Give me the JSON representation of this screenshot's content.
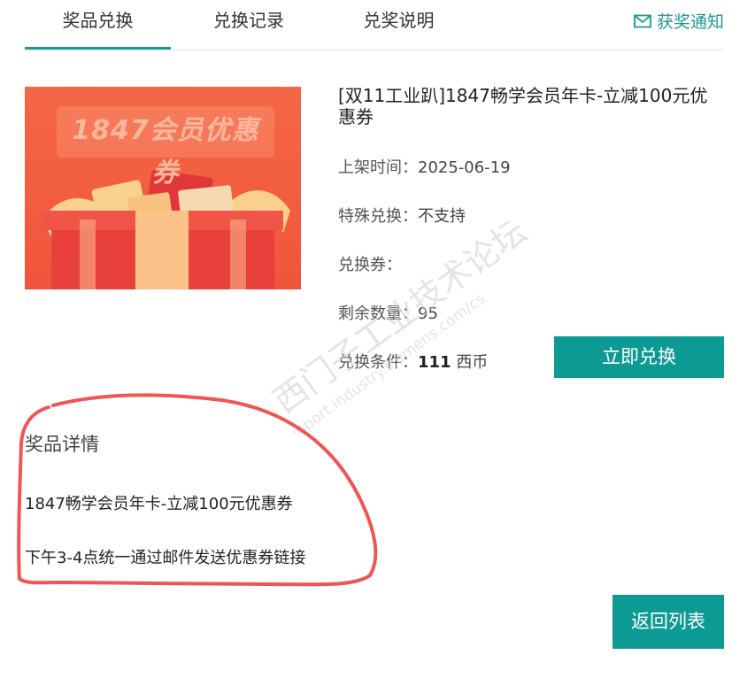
{
  "tabs": [
    {
      "label": "奖品兑换",
      "active": true
    },
    {
      "label": "兑换记录",
      "active": false
    },
    {
      "label": "兑奖说明",
      "active": false
    }
  ],
  "notify": {
    "label": "获奖通知",
    "icon": "mail-icon"
  },
  "product": {
    "image_banner_text": "1847会员优惠券",
    "title": "[双11工业趴]1847畅学会员年卡-立减100元优惠券",
    "fields": [
      {
        "label": "上架时间：",
        "value": "2025-06-19"
      },
      {
        "label": "特殊兑换：",
        "value": "不支持"
      },
      {
        "label": "兑换券：",
        "value": ""
      },
      {
        "label": "剩余数量：",
        "value": "95"
      }
    ],
    "condition": {
      "label": "兑换条件：",
      "amount": "111",
      "unit": "西币"
    },
    "redeem_label": "立即兑换"
  },
  "details": {
    "heading": "奖品详情",
    "lines": [
      "1847畅学会员年卡-立减100元优惠券",
      "下午3-4点统一通过邮件发送优惠券链接"
    ]
  },
  "back_label": "返回列表",
  "watermark": {
    "line1": "西门子工业技术论坛",
    "line2": "support.industry.siemens.com/cs"
  },
  "colors": {
    "accent": "#0e9a94",
    "annotation": "#f05555"
  }
}
